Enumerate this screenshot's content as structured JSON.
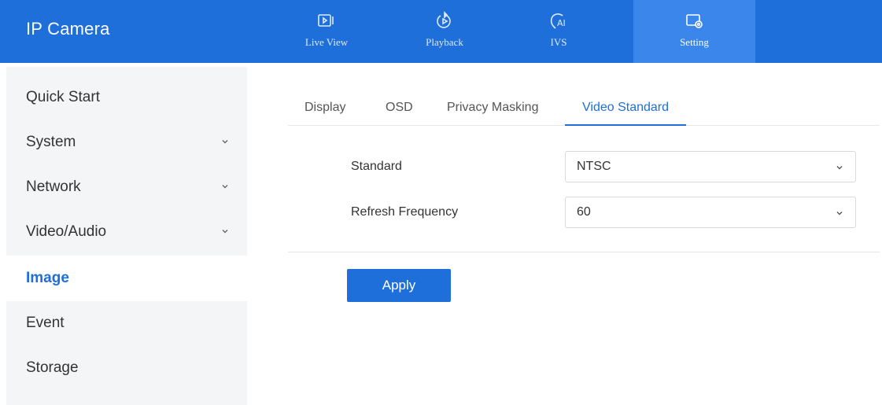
{
  "app": {
    "title": "IP Camera"
  },
  "nav": [
    {
      "label": "Live View",
      "icon": "live-view-icon"
    },
    {
      "label": "Playback",
      "icon": "playback-icon"
    },
    {
      "label": "IVS",
      "icon": "ai-icon"
    },
    {
      "label": "Setting",
      "icon": "setting-icon",
      "active": true
    }
  ],
  "sidebar": {
    "items": [
      {
        "label": "Quick Start"
      },
      {
        "label": "System",
        "expandable": true
      },
      {
        "label": "Network",
        "expandable": true
      },
      {
        "label": "Video/Audio",
        "expandable": true
      },
      {
        "label": "Image",
        "active": true
      },
      {
        "label": "Event"
      },
      {
        "label": "Storage"
      }
    ]
  },
  "tabs": [
    {
      "label": "Display"
    },
    {
      "label": "OSD"
    },
    {
      "label": "Privacy Masking"
    },
    {
      "label": "Video Standard",
      "active": true
    }
  ],
  "form": {
    "standard": {
      "label": "Standard",
      "value": "NTSC"
    },
    "refresh": {
      "label": "Refresh Frequency",
      "value": "60"
    }
  },
  "actions": {
    "apply_label": "Apply"
  },
  "colors": {
    "primary": "#1e6fd9",
    "nav_active": "#3a86ea",
    "sidebar_bg": "#f4f5f7"
  }
}
